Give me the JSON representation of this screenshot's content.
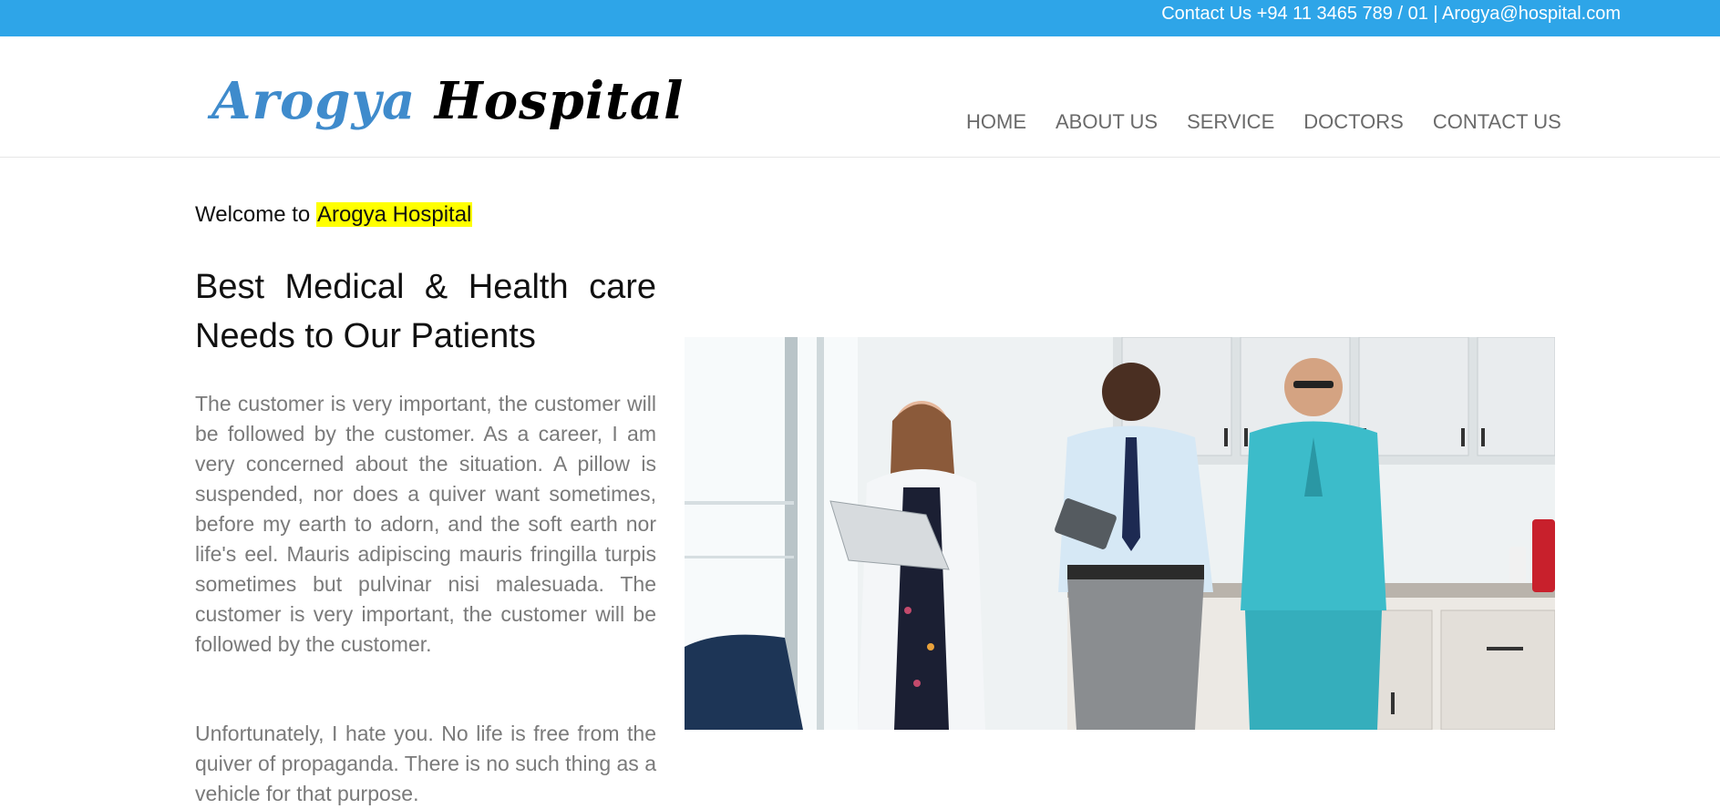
{
  "topbar": {
    "contact_text": "Contact Us +94 11 3465 789 / 01 | Arogya@hospital.com"
  },
  "header": {
    "logo": {
      "part1": "Arogya",
      "part2": "Hospital"
    },
    "nav": [
      {
        "label": "HOME"
      },
      {
        "label": "ABOUT US"
      },
      {
        "label": "SERVICE"
      },
      {
        "label": "DOCTORS"
      },
      {
        "label": "CONTACT US"
      }
    ]
  },
  "main": {
    "welcome_prefix": "Welcome to",
    "welcome_highlight": "Arogya Hospital",
    "headline": "Best Medical & Health care Needs to Our Patients",
    "paragraphs": [
      "The customer is very important, the customer will be followed by the customer. As a career, I am very concerned about the situation. A pillow is suspended, nor does a quiver want sometimes, before my earth to adorn, and the soft earth nor life's eel. Mauris adipiscing mauris fringilla turpis sometimes but pulvinar nisi malesuada. The customer is very important, the customer will be followed by the customer.",
      "Unfortunately, I hate you. No life is free from the quiver of propaganda. There is no such thing as a vehicle for that purpose."
    ]
  },
  "colors": {
    "topbar_bg": "#2ea5e8",
    "logo_blue": "#3f8bcc",
    "highlight": "#ffff00",
    "nav_text": "#6a6a6a",
    "body_text": "#7a7a7a"
  }
}
